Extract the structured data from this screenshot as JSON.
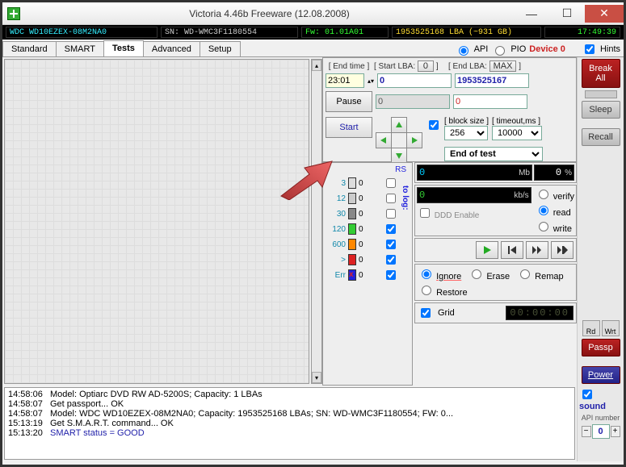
{
  "window": {
    "title": "Victoria 4.46b Freeware (12.08.2008)"
  },
  "info": {
    "model": "WDC WD10EZEX-08M2NA0",
    "serial": "SN: WD-WMC3F1180554",
    "firmware": "Fw: 01.01A01",
    "lba": "1953525168 LBA (~931 GB)",
    "time": "17:49:39"
  },
  "tabs": [
    "Standard",
    "SMART",
    "Tests",
    "Advanced",
    "Setup"
  ],
  "topright": {
    "api": "API",
    "pio": "PIO",
    "device": "Device 0",
    "hints": "Hints"
  },
  "test": {
    "end_time_label": "[ End time ]",
    "start_lba_label": "[ Start LBA:",
    "start_lba_btn": "0",
    "end_lba_label": "[ End LBA:",
    "end_lba_btn": "MAX",
    "end_time": "23:01",
    "start_lba": "0",
    "end_lba": "1953525167",
    "pause": "Pause",
    "second_start": "0",
    "second_end": "0",
    "start": "Start",
    "block_size_label": "[ block size ]",
    "block_size": "256",
    "timeout_label": "[ timeout,ms ]",
    "timeout": "10000",
    "end_of_test": "End of test"
  },
  "stats": {
    "rs": "RS",
    "tolog": "to log:",
    "rows": [
      {
        "label": "3",
        "color": "#ddd",
        "val": "0"
      },
      {
        "label": "12",
        "color": "#ccc",
        "val": "0"
      },
      {
        "label": "30",
        "color": "#888",
        "val": "0"
      },
      {
        "label": "120",
        "color": "#3c3",
        "val": "0"
      },
      {
        "label": "600",
        "color": "#f80",
        "val": "0"
      },
      {
        "label": ">",
        "color": "#d22",
        "val": "0"
      },
      {
        "label": "Err",
        "color": "#22d",
        "val": "0",
        "x": "x"
      }
    ]
  },
  "meters": {
    "mb": "0",
    "mb_unit": "Mb",
    "pct": "0",
    "pct_unit": "%",
    "kbs": "0",
    "kbs_unit": "kb/s",
    "ddd": "DDD Enable",
    "verify": "verify",
    "read": "read",
    "write": "write"
  },
  "actions": {
    "ignore": "Ignore",
    "erase": "Erase",
    "remap": "Remap",
    "restore": "Restore"
  },
  "bottom": {
    "grid": "Grid",
    "timer": "00:00:00"
  },
  "side": {
    "break": "Break",
    "all": "All",
    "sleep": "Sleep",
    "recall": "Recall",
    "rd": "Rd",
    "wrt": "Wrt",
    "passp": "Passp",
    "power": "Power",
    "sound": "sound",
    "api_number": "API number",
    "num": "0"
  },
  "log": [
    {
      "t": "14:58:06",
      "m": "Model: Optiarc DVD RW AD-5200S; Capacity: 1 LBAs"
    },
    {
      "t": "14:58:07",
      "m": "Get passport... OK"
    },
    {
      "t": "14:58:07",
      "m": "Model: WDC WD10EZEX-08M2NA0; Capacity: 1953525168 LBAs; SN: WD-WMC3F1180554; FW: 0..."
    },
    {
      "t": "15:13:19",
      "m": "Get S.M.A.R.T. command... OK"
    },
    {
      "t": "15:13:20",
      "m": "SMART status = GOOD",
      "c": "#22a"
    }
  ]
}
